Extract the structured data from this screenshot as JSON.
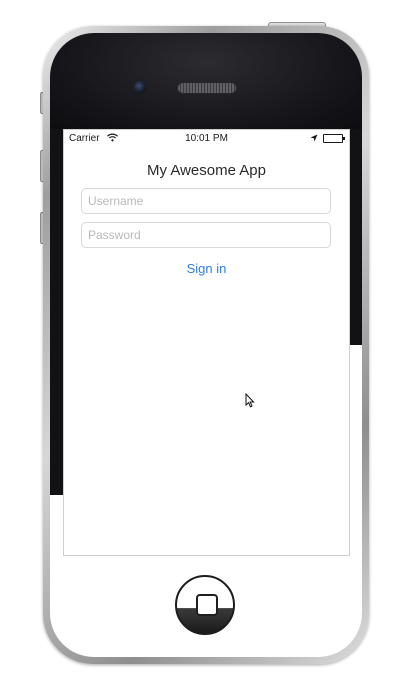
{
  "status_bar": {
    "carrier": "Carrier",
    "time": "10:01 PM",
    "icons": [
      "wifi-icon",
      "location-icon",
      "battery-icon"
    ]
  },
  "app": {
    "title": "My Awesome App",
    "username_placeholder": "Username",
    "username_value": "",
    "password_placeholder": "Password",
    "password_value": "",
    "sign_in_label": "Sign in"
  },
  "colors": {
    "accent": "#2f7fd6",
    "title_text": "#2b2b2b",
    "placeholder": "#b9b9b9",
    "field_border": "#d8d8d8",
    "device_face": "#15151a"
  }
}
